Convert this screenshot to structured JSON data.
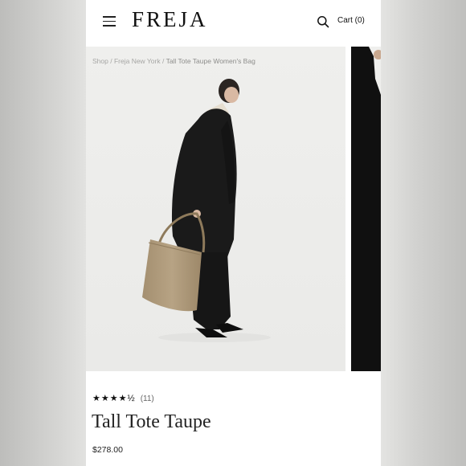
{
  "brand": {
    "logo": "FREJA"
  },
  "header": {
    "cart_label": "Cart (0)"
  },
  "breadcrumb": {
    "items": [
      "Shop",
      "Freja New York",
      "Tall Tote Taupe Women's Bag"
    ],
    "separator": "/"
  },
  "product": {
    "rating_stars": "★★★★½",
    "rating_value": 4.5,
    "review_count": "(11)",
    "title": "Tall Tote Taupe",
    "price": "$278.00"
  },
  "colors": {
    "accent": "#111111",
    "bag": "#b19d7e",
    "coat": "#1a1a1a",
    "backdrop": "#f0f0ee"
  },
  "icons": [
    "menu-icon",
    "search-icon"
  ]
}
